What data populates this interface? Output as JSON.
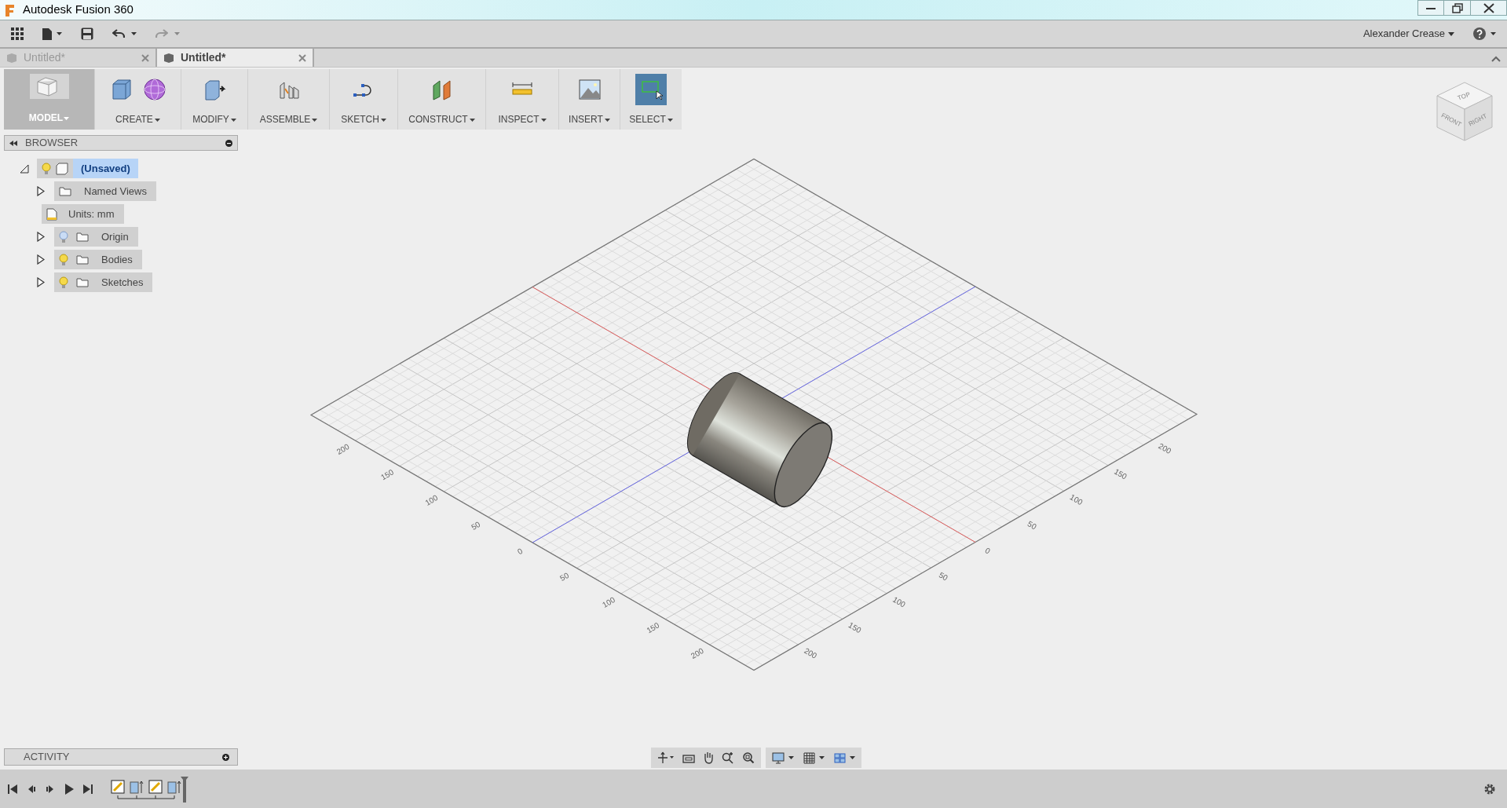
{
  "window": {
    "title": "Autodesk Fusion 360"
  },
  "user": {
    "name": "Alexander Crease"
  },
  "document_tabs": [
    {
      "label": "Untitled*",
      "selected": false
    },
    {
      "label": "Untitled*",
      "selected": true
    }
  ],
  "workspace": {
    "label": "MODEL"
  },
  "tool_groups": [
    {
      "label": "CREATE",
      "active": false
    },
    {
      "label": "MODIFY",
      "active": false
    },
    {
      "label": "ASSEMBLE",
      "active": false
    },
    {
      "label": "SKETCH",
      "active": false
    },
    {
      "label": "CONSTRUCT",
      "active": false
    },
    {
      "label": "INSPECT",
      "active": false
    },
    {
      "label": "INSERT",
      "active": false
    },
    {
      "label": "SELECT",
      "active": true
    }
  ],
  "browser": {
    "title": "BROWSER",
    "root": {
      "label": "(Unsaved)",
      "expanded": true,
      "selected": true,
      "visible": true,
      "children": [
        {
          "kind": "folder",
          "label": "Named Views",
          "expanded": false
        },
        {
          "kind": "units",
          "label": "Units: mm"
        },
        {
          "kind": "folder",
          "label": "Origin",
          "expanded": false,
          "visible": false
        },
        {
          "kind": "folder",
          "label": "Bodies",
          "expanded": false,
          "visible": true
        },
        {
          "kind": "folder",
          "label": "Sketches",
          "expanded": false,
          "visible": true
        }
      ]
    }
  },
  "viewcube": {
    "top": "TOP",
    "front": "FRONT",
    "right": "RIGHT"
  },
  "grid_labels": {
    "left_edge": [
      "200",
      "150",
      "100",
      "50",
      "0",
      "50",
      "100",
      "150",
      "200"
    ],
    "right_edge": [
      "200",
      "150",
      "100",
      "50",
      "0",
      "50",
      "100",
      "150",
      "200"
    ]
  },
  "activity": {
    "title": "ACTIVITY"
  }
}
